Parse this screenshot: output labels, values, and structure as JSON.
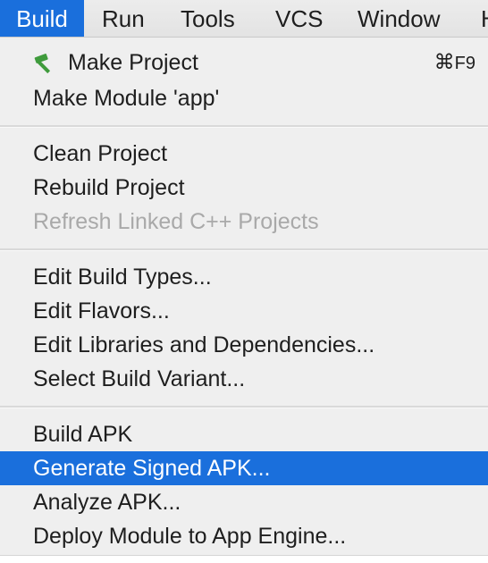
{
  "menubar": {
    "items": [
      {
        "label": "Build"
      },
      {
        "label": "Run"
      },
      {
        "label": "Tools"
      },
      {
        "label": "VCS"
      },
      {
        "label": "Window"
      },
      {
        "label": "H"
      }
    ]
  },
  "build_menu": {
    "groups": [
      [
        {
          "label": "Make Project",
          "shortcut_symbol": "⌘",
          "shortcut_key": "F9",
          "icon": "hammer-icon"
        },
        {
          "label": "Make Module 'app'"
        }
      ],
      [
        {
          "label": "Clean Project"
        },
        {
          "label": "Rebuild Project"
        },
        {
          "label": "Refresh Linked C++ Projects",
          "disabled": true
        }
      ],
      [
        {
          "label": "Edit Build Types..."
        },
        {
          "label": "Edit Flavors..."
        },
        {
          "label": "Edit Libraries and Dependencies..."
        },
        {
          "label": "Select Build Variant..."
        }
      ],
      [
        {
          "label": "Build APK"
        },
        {
          "label": "Generate Signed APK...",
          "highlighted": true
        },
        {
          "label": "Analyze APK..."
        },
        {
          "label": "Deploy Module to App Engine..."
        }
      ]
    ]
  },
  "colors": {
    "highlight": "#1a6fdc",
    "menu_background": "#efefef",
    "disabled_text": "#a9a9a9",
    "hammer_icon": "#3f9b3c"
  }
}
